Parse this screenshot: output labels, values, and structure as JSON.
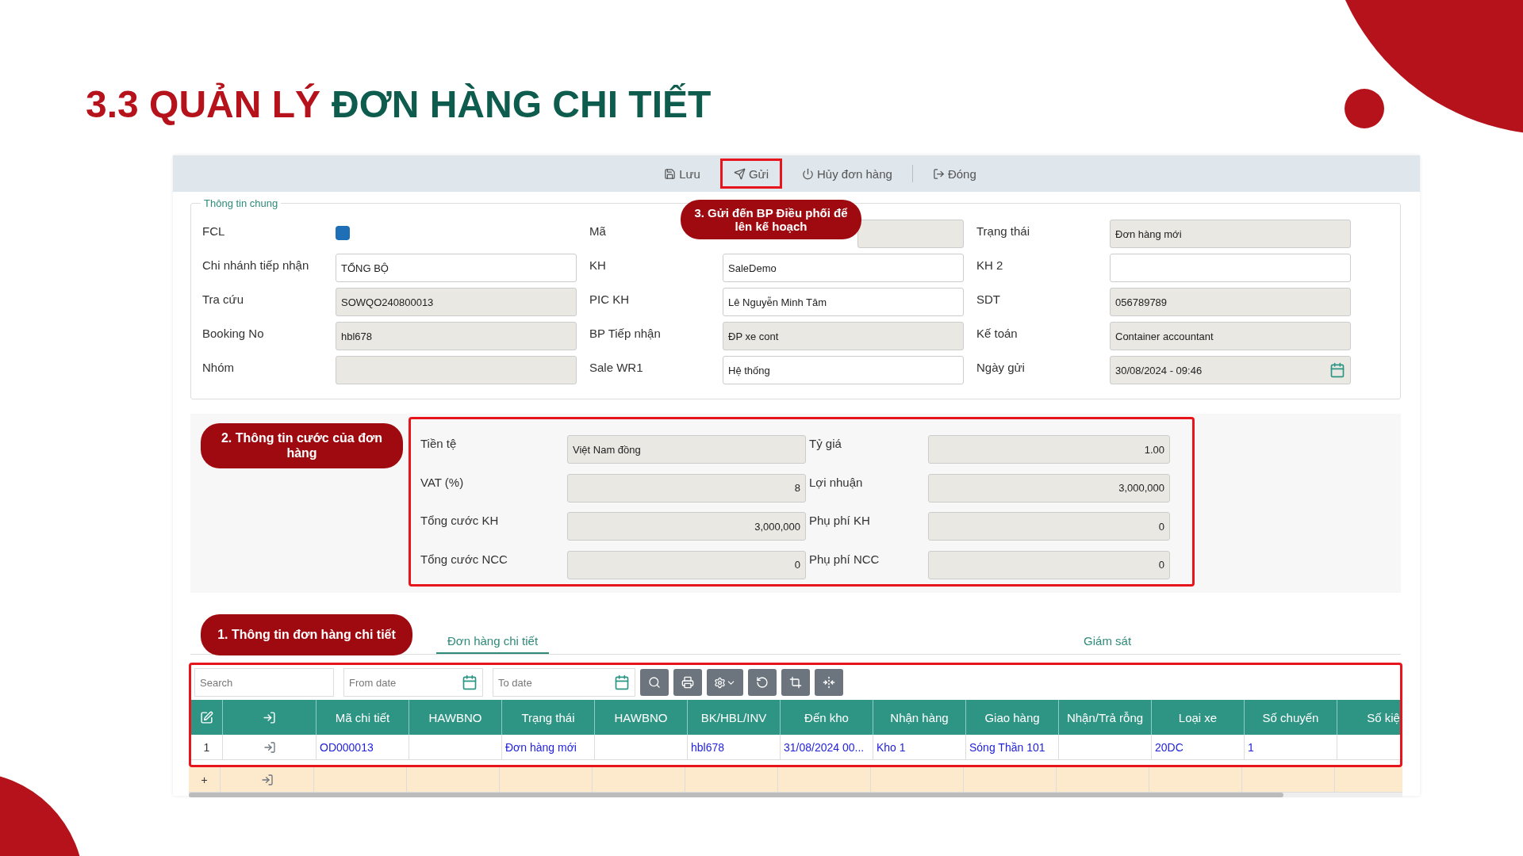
{
  "slide_title": {
    "part_1": "3.3 QUẢN LÝ",
    "part_2": "ĐƠN HÀNG CHI TIẾT"
  },
  "toolbar": [
    {
      "kind": "save",
      "label": "Lưu",
      "highlighted": false
    },
    {
      "kind": "send",
      "label": "Gửi",
      "highlighted": true
    },
    {
      "kind": "cancel",
      "label": "Hủy đơn hàng",
      "highlighted": false
    },
    {
      "kind": "close",
      "label": "Đóng",
      "highlighted": false
    }
  ],
  "general_info": {
    "legend": "Thông tin chung",
    "fields": [
      {
        "label": "FCL",
        "kind": "checkbox",
        "checked": true
      },
      {
        "label": "Mã",
        "kind": "input",
        "readonly": true
      },
      {
        "label": "Trạng thái",
        "kind": "input",
        "value": "Đơn hàng mới",
        "readonly": true
      },
      {
        "label": "Chi nhánh tiếp nhận",
        "kind": "input",
        "value": "TỔNG BỘ",
        "readonly": false
      },
      {
        "label": "KH",
        "kind": "input",
        "value": "SaleDemo",
        "readonly": false
      },
      {
        "label": "KH 2",
        "kind": "input",
        "readonly": false
      },
      {
        "label": "Tra cứu",
        "kind": "input",
        "value": "SOWQO240800013",
        "readonly": true
      },
      {
        "label": "PIC KH",
        "kind": "input",
        "value": "Lê Nguyễn Minh Tâm",
        "readonly": false
      },
      {
        "label": "SDT",
        "kind": "input",
        "value": "056789789",
        "readonly": true
      },
      {
        "label": "Booking No",
        "kind": "input",
        "value": "hbl678",
        "readonly": true
      },
      {
        "label": "BP Tiếp nhận",
        "kind": "input",
        "value": "ĐP xe cont",
        "readonly": true
      },
      {
        "label": "Kế toán",
        "kind": "input",
        "value": "Container accountant",
        "readonly": true
      },
      {
        "label": "Nhóm",
        "kind": "input",
        "readonly": true
      },
      {
        "label": "Sale WR1",
        "kind": "input",
        "value": "Hệ thống",
        "readonly": false
      },
      {
        "label": "Ngày gửi",
        "kind": "date",
        "value": "30/08/2024 - 09:46",
        "readonly": true
      }
    ]
  },
  "fees": {
    "fields": [
      {
        "label": "Tiền tệ",
        "value": "Việt Nam đồng",
        "kind": "text"
      },
      {
        "label": "Tỷ giá",
        "value": "1.00",
        "kind": "number"
      },
      {
        "label": "VAT (%)",
        "value": "8",
        "kind": "number"
      },
      {
        "label": "Lợi nhuận",
        "value": "3,000,000",
        "kind": "number"
      },
      {
        "label": "Tổng cước KH",
        "value": "3,000,000",
        "kind": "number"
      },
      {
        "label": "Phụ phí KH",
        "value": "0",
        "kind": "number"
      },
      {
        "label": "Tổng cước NCC",
        "value": "0",
        "kind": "number"
      },
      {
        "label": "Phụ phí NCC",
        "value": "0",
        "kind": "number"
      }
    ]
  },
  "annotations": [
    "3. Gửi đến BP Điều phối để lên kế hoạch",
    "2. Thông tin cước của đơn hàng",
    "1. Thông tin đơn hàng chi tiết"
  ],
  "tabs": [
    {
      "label": "Đơn hàng chi tiết",
      "selected": true
    },
    {
      "label": "Giám sát",
      "selected": false
    }
  ],
  "grid": {
    "search_placeholder": "Search",
    "from_placeholder": "From date",
    "to_placeholder": "To date",
    "columns": [
      "Mã chi tiết",
      "HAWBNO",
      "Trạng thái",
      "HAWBNO",
      "BK/HBL/INV",
      "Đến kho",
      "Nhận hàng",
      "Giao hàng",
      "Nhận/Trả rỗng",
      "Loại xe",
      "Số chuyến",
      "Số kiệ"
    ],
    "rows": [
      {
        "kind": "data",
        "number": "1",
        "cells": [
          "OD000013",
          "",
          "Đơn hàng mới",
          "",
          "hbl678",
          "31/08/2024 00...",
          "Kho 1",
          "Sóng Thần 101",
          "",
          "20DC",
          "1",
          ""
        ]
      },
      {
        "kind": "new",
        "number": "+",
        "cells": [
          "",
          "",
          "",
          "",
          "",
          "",
          "",
          "",
          "",
          "",
          "",
          ""
        ]
      }
    ]
  }
}
